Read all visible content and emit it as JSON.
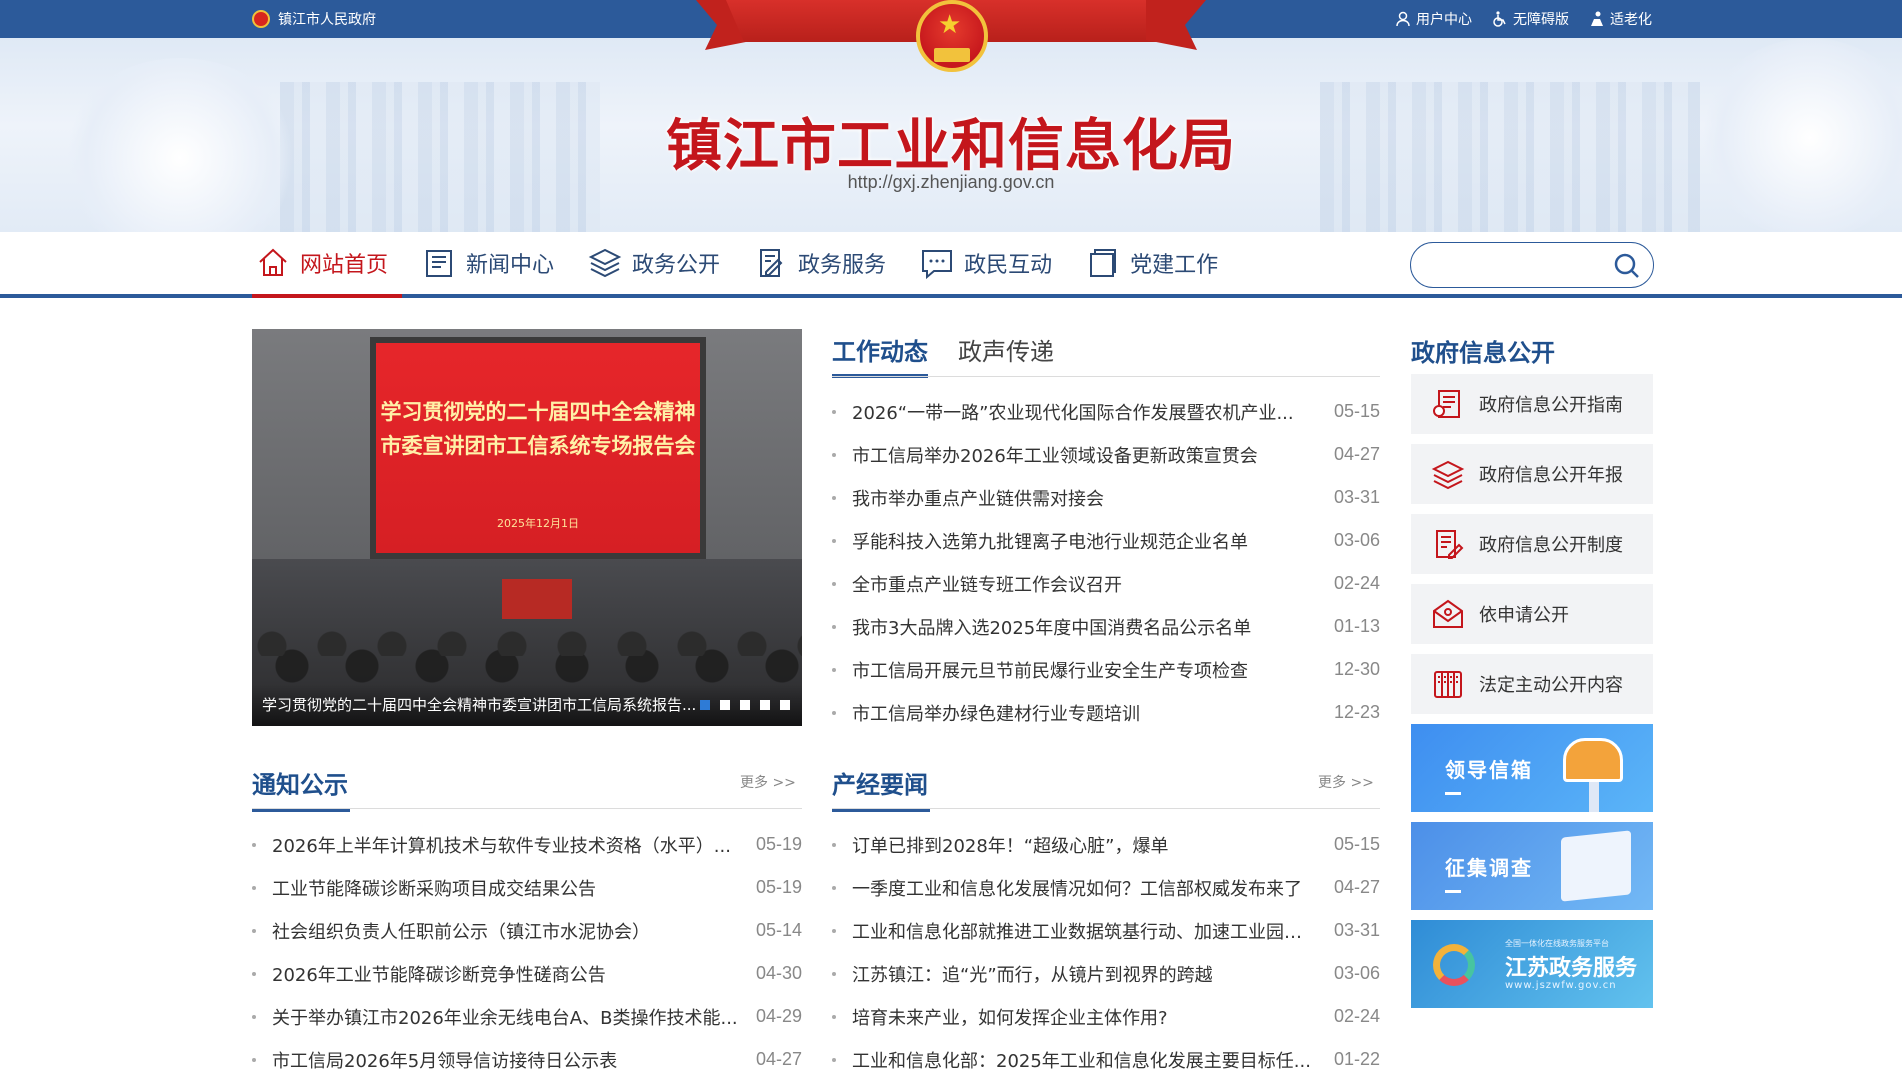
{
  "topbar": {
    "gov_link": "镇江市人民政府",
    "user_center": "用户中心",
    "accessibility": "无障碍版",
    "elderly": "适老化"
  },
  "banner": {
    "title": "镇江市工业和信息化局",
    "url": "http://gxj.zhenjiang.gov.cn"
  },
  "nav": {
    "items": [
      {
        "label": "网站首页",
        "icon": "home-icon",
        "active": true
      },
      {
        "label": "新闻中心",
        "icon": "news-icon"
      },
      {
        "label": "政务公开",
        "icon": "layers-icon"
      },
      {
        "label": "政务服务",
        "icon": "service-icon"
      },
      {
        "label": "政民互动",
        "icon": "chat-icon"
      },
      {
        "label": "党建工作",
        "icon": "party-icon"
      }
    ],
    "search_placeholder": ""
  },
  "slider": {
    "screen_line1": "学习贯彻党的二十届四中全会精神",
    "screen_line2": "市委宣讲团市工信系统专场报告会",
    "screen_date": "2025年12月1日",
    "caption": "学习贯彻党的二十届四中全会精神市委宣讲团市工信局系统报告...",
    "dots": 5,
    "active_dot": 0
  },
  "news_tabs": {
    "tabs": [
      "工作动态",
      "政声传递"
    ],
    "items": [
      {
        "title": "2026“一带一路”农业现代化国际合作发展暨农机产业...",
        "date": "05-15"
      },
      {
        "title": "市工信局举办2026年工业领域设备更新政策宣贯会",
        "date": "04-27"
      },
      {
        "title": "我市举办重点产业链供需对接会",
        "date": "03-31"
      },
      {
        "title": "孚能科技入选第九批锂离子电池行业规范企业名单",
        "date": "03-06"
      },
      {
        "title": "全市重点产业链专班工作会议召开",
        "date": "02-24"
      },
      {
        "title": "我市3大品牌入选2025年度中国消费名品公示名单",
        "date": "01-13"
      },
      {
        "title": "市工信局开展元旦节前民爆行业安全生产专项检查",
        "date": "12-30"
      },
      {
        "title": "市工信局举办绿色建材行业专题培训",
        "date": "12-23"
      }
    ]
  },
  "notices": {
    "title": "通知公示",
    "more": "更多 >>",
    "items": [
      {
        "title": "2026年上半年计算机技术与软件专业技术资格（水平）...",
        "date": "05-19"
      },
      {
        "title": "工业节能降碳诊断采购项目成交结果公告",
        "date": "05-19"
      },
      {
        "title": "社会组织负责人任职前公示（镇江市水泥协会）",
        "date": "05-14"
      },
      {
        "title": "2026年工业节能降碳诊断竞争性磋商公告",
        "date": "04-30"
      },
      {
        "title": "关于举办镇江市2026年业余无线电台A、B类操作技术能...",
        "date": "04-29"
      },
      {
        "title": "市工信局2026年5月领导信访接待日公示表",
        "date": "04-27"
      }
    ]
  },
  "industry": {
    "title": "产经要闻",
    "more": "更多 >>",
    "items": [
      {
        "title": "订单已排到2028年！“超级心脏”，爆单",
        "date": "05-15"
      },
      {
        "title": "一季度工业和信息化发展情况如何？工信部权威发布来了",
        "date": "04-27"
      },
      {
        "title": "工业和信息化部就推进工业数据筑基行动、加速工业园区...",
        "date": "03-31"
      },
      {
        "title": "江苏镇江：追“光”而行，从镜片到视界的跨越",
        "date": "03-06"
      },
      {
        "title": "培育未来产业，如何发挥企业主体作用?",
        "date": "02-24"
      },
      {
        "title": "工业和信息化部：2025年工业和信息化发展主要目标任...",
        "date": "01-22"
      }
    ]
  },
  "gov_info": {
    "title": "政府信息公开",
    "items": [
      {
        "label": "政府信息公开指南",
        "icon": "guide-icon"
      },
      {
        "label": "政府信息公开年报",
        "icon": "report-stack-icon"
      },
      {
        "label": "政府信息公开制度",
        "icon": "rules-doc-icon"
      },
      {
        "label": "依申请公开",
        "icon": "envelope-open-icon"
      },
      {
        "label": "法定主动公开内容",
        "icon": "book-columns-icon"
      }
    ]
  },
  "promos": {
    "mailbox": "领导信箱",
    "survey": "征集调查",
    "jiangsu": "江苏政务服务",
    "jiangsu_url": "www.jszwfw.gov.cn",
    "jiangsu_small": "全国一体化在线政务服务平台"
  },
  "colors": {
    "primary_blue": "#2c5a9a",
    "accent_red": "#c4161c",
    "title_blue": "#1f4f8c"
  }
}
